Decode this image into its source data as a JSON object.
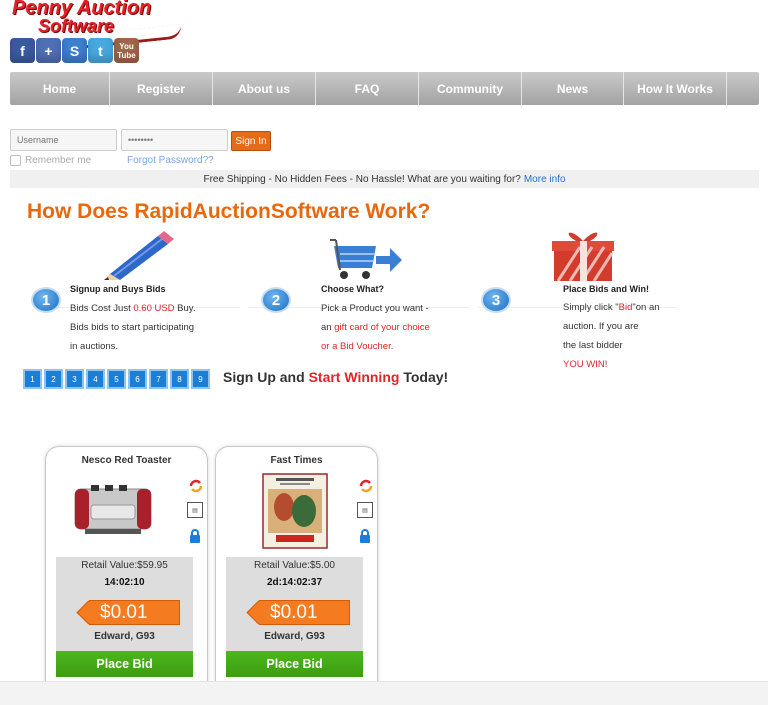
{
  "logo": {
    "line1": "Penny Auction",
    "line2": "Software"
  },
  "social": [
    {
      "icon": "facebook-icon",
      "glyph": "f"
    },
    {
      "icon": "google-plus-icon",
      "glyph": "+"
    },
    {
      "icon": "stumbleupon-icon",
      "glyph": "S"
    },
    {
      "icon": "twitter-icon",
      "glyph": "t"
    },
    {
      "icon": "youtube-icon",
      "glyph": "You Tube"
    }
  ],
  "nav": [
    "Home",
    "Register",
    "About us",
    "FAQ",
    "Community",
    "News",
    "How It Works"
  ],
  "login": {
    "username_placeholder": "Username",
    "password_value": "••••••••",
    "signin_label": "Sign In",
    "remember_label": "Remember me",
    "forgot_label": "Forgot Password??"
  },
  "shipping": {
    "text": "Free Shipping - No Hidden Fees - No Hassle! What are you waiting for?",
    "link": "More info"
  },
  "how": {
    "title": "How Does RapidAuctionSoftware Work?",
    "steps": [
      {
        "num": "1",
        "heading": "Signup and Buys Bids",
        "lines": [
          "Bids Cost Just ",
          "0.60 USD",
          " Buy.",
          "Bids bids to start participating",
          "in auctions."
        ]
      },
      {
        "num": "2",
        "heading": "Choose What?",
        "lines": [
          "Pick a Product you want -",
          "an ",
          "gift card of your choice",
          "or a Bid Voucher."
        ]
      },
      {
        "num": "3",
        "heading": "Place Bids and Win!",
        "lines": [
          "Simply click \"",
          "Bid",
          "\"on an",
          "auction. If you are",
          "the last bidder",
          "YOU WIN!"
        ]
      }
    ]
  },
  "pagination": [
    "1",
    "2",
    "3",
    "4",
    "5",
    "6",
    "7",
    "8",
    "9"
  ],
  "signup": {
    "pre": "Sign Up and ",
    "highlight": "Start Winning",
    "post": " Today!"
  },
  "products": [
    {
      "title": "Nesco Red Toaster",
      "retail": "Retail Value:$59.95",
      "timer": "14:02:10",
      "price": "$0.01",
      "bidder": "Edward, G93",
      "bid_label": "Place Bid"
    },
    {
      "title": "Fast Times",
      "retail": "Retail Value:$5.00",
      "timer": "2d:14:02:37",
      "price": "$0.01",
      "bidder": "Edward, G93",
      "bid_label": "Place Bid"
    }
  ],
  "colors": {
    "accent": "#e8680e",
    "red": "#e0242a",
    "blue": "#1b7fd8",
    "green": "#46ad16"
  }
}
